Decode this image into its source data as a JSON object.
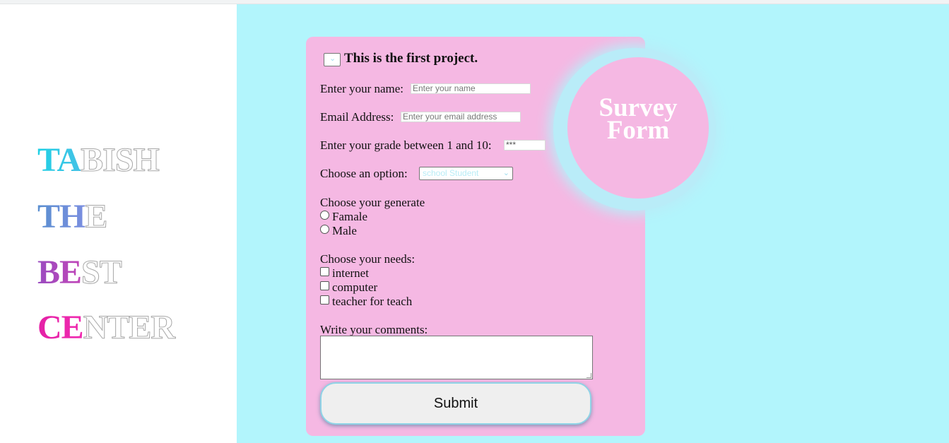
{
  "brand": {
    "words": [
      {
        "highlight": "TA",
        "rest": "BISH"
      },
      {
        "highlight": "TH",
        "rest": "E"
      },
      {
        "highlight": "BE",
        "rest": "ST"
      },
      {
        "highlight": "CE",
        "rest": "NTER"
      }
    ]
  },
  "form": {
    "heading": "This is the first project.",
    "badge": {
      "line1": "Survey",
      "line2": "Form"
    },
    "name": {
      "label": "Enter your name:",
      "placeholder": "Enter your name"
    },
    "email": {
      "label": "Email Address:",
      "placeholder": "Enter your email address"
    },
    "grade": {
      "label": "Enter your grade between 1 and 10:",
      "value": "***"
    },
    "option": {
      "label": "Choose an option:",
      "selected": "school Student"
    },
    "gender": {
      "label": "Choose your generate",
      "options": [
        "Famale",
        "Male"
      ]
    },
    "needs": {
      "label": "Choose your needs:",
      "options": [
        "internet",
        "computer",
        "teacher for teach"
      ]
    },
    "comments": {
      "label": "Write your comments:"
    },
    "submit_label": "Submit"
  },
  "colors": {
    "page_bg": "#ffffff",
    "right_bg": "#b2f5fc",
    "card_bg": "#f5b8e3",
    "ring": "#b9ecf8",
    "highlight_cyan": "#1fd0e5",
    "highlight_blue": "#5a8fd0",
    "highlight_purple": "#9a4cc0",
    "highlight_pink": "#e421a6"
  },
  "icons": {
    "select_arrow": "chevron-down-icon"
  }
}
